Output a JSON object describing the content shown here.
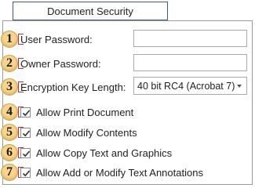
{
  "tab": {
    "label": "Document Security"
  },
  "fields": [
    {
      "badge": "1",
      "label": "User Password:",
      "value": ""
    },
    {
      "badge": "2",
      "label": "Owner Password:",
      "value": ""
    },
    {
      "badge": "3",
      "label": "Encryption Key Length:",
      "selected": "40 bit RC4 (Acrobat 7)"
    }
  ],
  "checkboxes": [
    {
      "badge": "4",
      "label": "Allow Print Document",
      "checked": true
    },
    {
      "badge": "5",
      "label": "Allow Modify Contents",
      "checked": true
    },
    {
      "badge": "6",
      "label": "Allow Copy Text and Graphics",
      "checked": true
    },
    {
      "badge": "7",
      "label": "Allow Add or Modify Text Annotations",
      "checked": true
    }
  ],
  "colors": {
    "badge": "#f7d58f",
    "tab_border": "#3b5a8c",
    "marker": "#d22a2a"
  }
}
